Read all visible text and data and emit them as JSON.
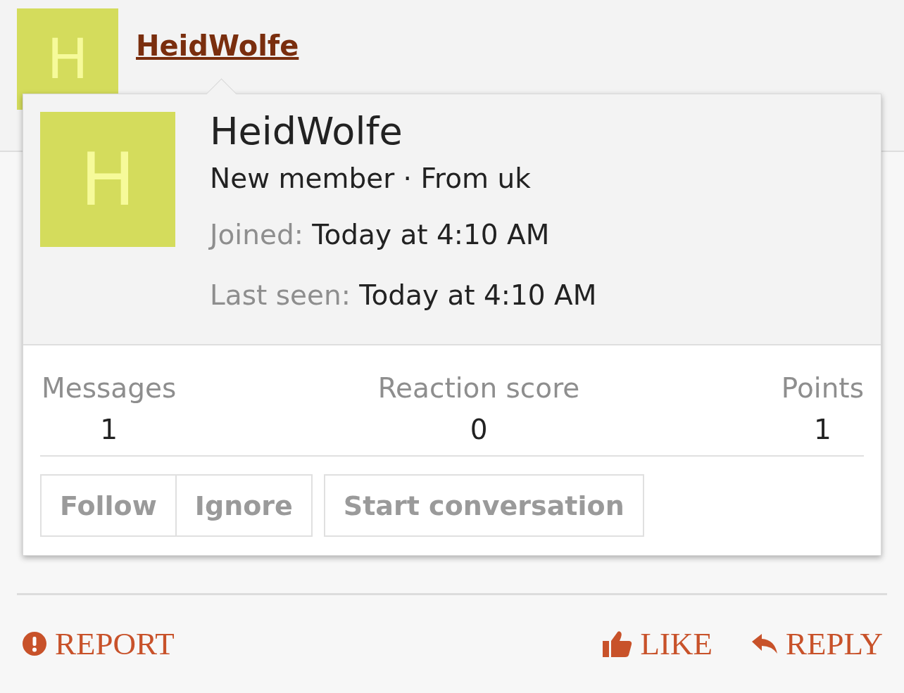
{
  "user": {
    "avatar_letter": "H",
    "name": "HeidWolfe"
  },
  "popup": {
    "avatar_letter": "H",
    "name": "HeidWolfe",
    "subtitle": "New member · From uk",
    "details": [
      {
        "label": "Joined:",
        "value": "Today at 4:10 AM"
      },
      {
        "label": "Last seen:",
        "value": "Today at 4:10 AM"
      }
    ],
    "stats": [
      {
        "label": "Messages",
        "value": "1"
      },
      {
        "label": "Reaction score",
        "value": "0"
      },
      {
        "label": "Points",
        "value": "1"
      }
    ],
    "button_groups": [
      [
        "Follow",
        "Ignore"
      ],
      [
        "Start conversation"
      ]
    ]
  },
  "actions": [
    {
      "kind": "report",
      "label": "REPORT"
    },
    {
      "kind": "like",
      "label": "LIKE"
    },
    {
      "kind": "reply",
      "label": "REPLY"
    }
  ]
}
